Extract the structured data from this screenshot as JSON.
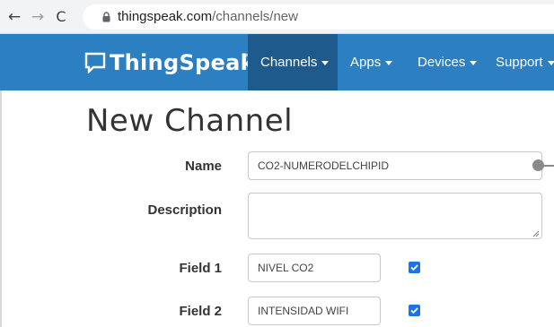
{
  "browser": {
    "url_domain": "thingspeak.com",
    "url_path": "/channels/new",
    "icons": [
      "back-arrow-icon",
      "forward-arrow-icon",
      "reload-icon",
      "lock-icon"
    ]
  },
  "navbar": {
    "brand": "ThingSpeak",
    "trademark": "™",
    "items": [
      {
        "label": "Channels",
        "active": true
      },
      {
        "label": "Apps",
        "active": false
      },
      {
        "label": "Devices",
        "active": false
      },
      {
        "label": "Support",
        "active": false
      }
    ],
    "colors": {
      "bar": "#2c7fc0",
      "active": "#1f5a8c"
    }
  },
  "page": {
    "title": "New Channel"
  },
  "form": {
    "name": {
      "label": "Name",
      "value": "CO2-NUMERODELCHIPID"
    },
    "description": {
      "label": "Description",
      "value": ""
    },
    "fields": [
      {
        "label": "Field 1",
        "value": "NIVEL CO2",
        "checked": true
      },
      {
        "label": "Field 2",
        "value": "INTENSIDAD WIFI",
        "checked": true
      }
    ]
  }
}
